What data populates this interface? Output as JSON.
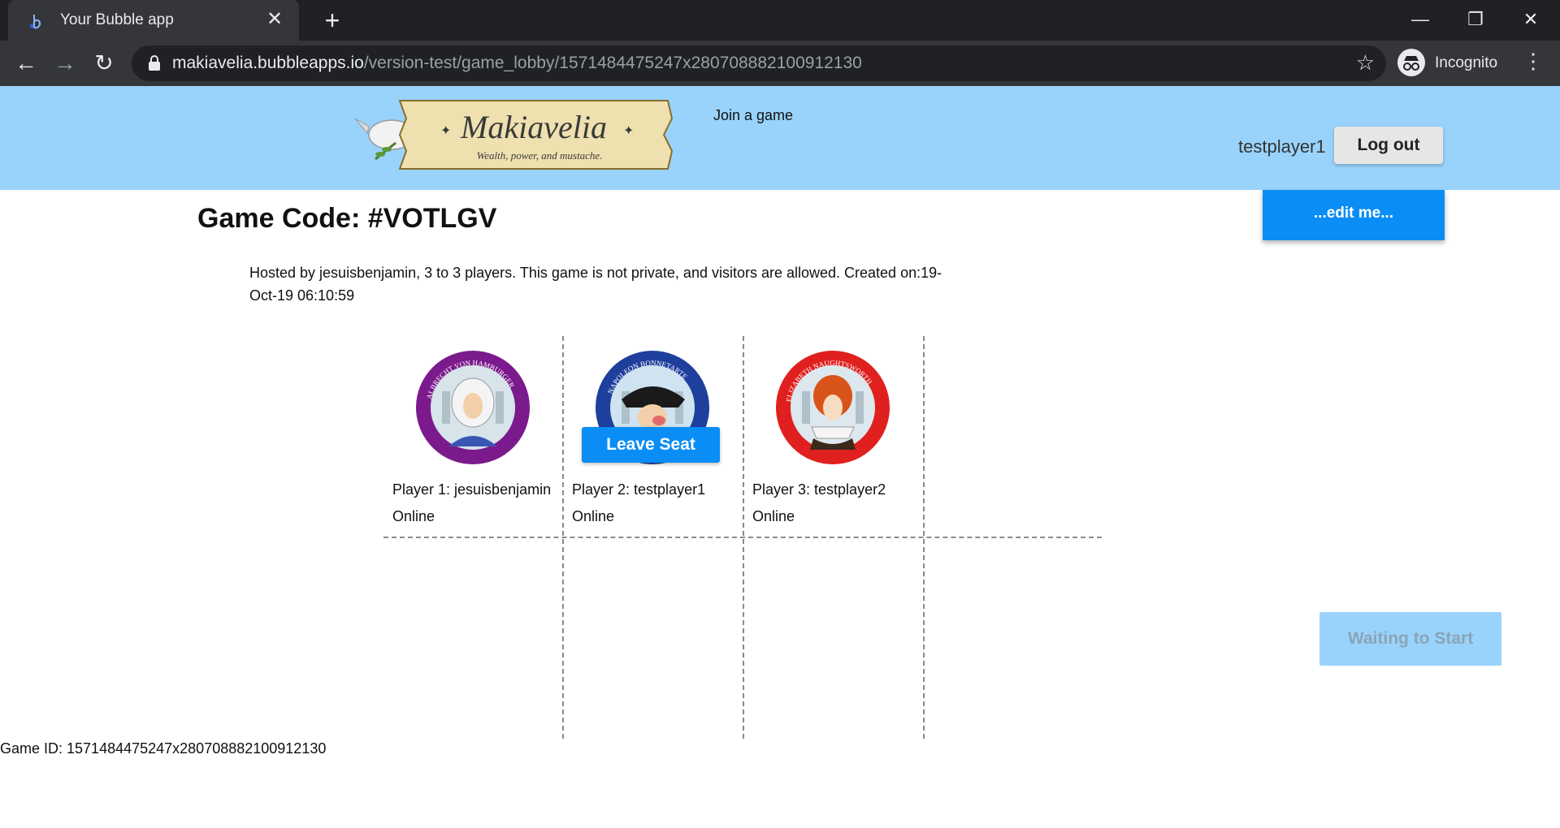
{
  "browser": {
    "tab_title": "Your Bubble app",
    "url_host": "makiavelia.bubbleapps.io",
    "url_path": "/version-test/game_lobby/1571484475247x280708882100912130",
    "profile_label": "Incognito",
    "icons": [
      "bubble-favicon",
      "close-icon",
      "plus-icon",
      "minimize-icon",
      "restore-icon",
      "close-window-icon",
      "back-arrow-icon",
      "forward-arrow-icon",
      "reload-icon",
      "lock-icon",
      "star-icon",
      "incognito-icon",
      "kebab-menu-icon"
    ]
  },
  "header": {
    "logo_title": "Makiavelia",
    "logo_tagline": "Wealth, power, and mustache.",
    "join_link": "Join a game",
    "username": "testplayer1",
    "logout_label": "Log out",
    "background_color": "#99d3fb"
  },
  "lobby": {
    "game_code": "Game Code: #VOTLGV",
    "edit_label": "...edit me...",
    "hosted_text": "Hosted by jesuisbenjamin, 3 to 3 players. This game is not private, and visitors are allowed. Created on:19-Oct-19 06:10:59",
    "leave_seat_label": "Leave Seat",
    "waiting_label": "Waiting to Start",
    "game_id": "Game ID: 1571484475247x280708882100912130",
    "accent_color": "#0a8df5"
  },
  "players": [
    {
      "name": "Player 1: jesuisbenjamin",
      "status": "Online",
      "portrait_ring_text": "ALBRECHT VON HAMBURGER",
      "ring_color": "#7b1a8c"
    },
    {
      "name": "Player 2: testplayer1",
      "status": "Online",
      "portrait_ring_text": "NAPOLEON BONNETARTE",
      "ring_color": "#1f3f9c"
    },
    {
      "name": "Player 3: testplayer2",
      "status": "Online",
      "portrait_ring_text": "ELIZABETH NAUGHTSWORTH",
      "ring_color": "#e0201e"
    }
  ]
}
